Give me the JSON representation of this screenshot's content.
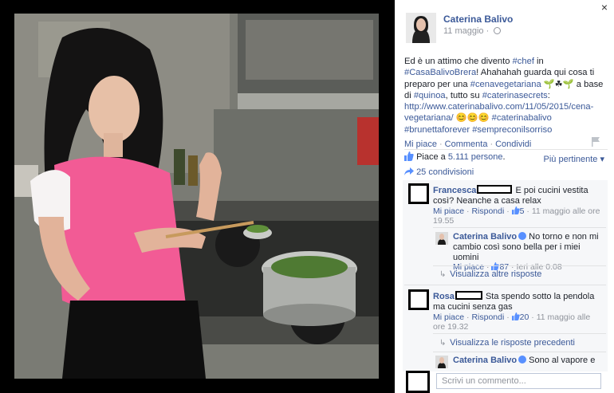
{
  "post": {
    "author": "Caterina Balivo",
    "date": "11 maggio · ",
    "text": {
      "p1": "Ed è un attimo che divento ",
      "tag_chef": "#chef",
      "p2": " in ",
      "tag_casa": "#CasaBalivoBrera",
      "p3": "! Ahahahah guarda qui cosa ti preparo per una ",
      "tag_cena": "#cenavegetariana",
      "emoji1": " 🌱☘🌱 ",
      "p4": "a base di ",
      "tag_quinoa": "#quinoa",
      "p5": ", tutto su ",
      "tag_secrets": "#caterinasecrets",
      "p6": ": ",
      "link": "http://www.caterinabalivo.com/11/05/2015/cena-vegetariana/",
      "emoji2": " 😊😊😊 ",
      "tag_cb": "#caterinabalivo",
      "tag_brunetta": "#brunettaforever",
      "tag_sorriso": "#sempreconilsorriso"
    }
  },
  "actions": {
    "like": "Mi piace",
    "comment": "Commenta",
    "share": "Condividi",
    "dot": "·"
  },
  "likes": {
    "prefix": "Piace a ",
    "count": "5.111 persone",
    "suffix": ".",
    "sort": "Più pertinente ▾"
  },
  "shares": {
    "label": "25 condivisioni"
  },
  "comments": [
    {
      "name": "Francesca",
      "text": " E poi cucini vestita così? Neanche a casa relax",
      "like": "Mi piace",
      "reply": "Rispondi",
      "likes": "5",
      "time": "11 maggio alle ore 19.55",
      "dot": " · "
    },
    {
      "name": "Caterina Balivo",
      "text": "No torno e non mi cambio così sono bella per i miei uomini",
      "like": "Mi piace",
      "likes": "87",
      "time": "Ieri alle 0.08",
      "dot": " · "
    },
    {
      "name": "Rosa",
      "text": " Sta spendo sotto la pendola ma cucini senza gas",
      "like": "Mi piace",
      "reply": "Rispondi",
      "likes": "20",
      "time": "11 maggio alle ore 19.32",
      "dot": " · "
    },
    {
      "name": "Caterina Balivo",
      "text": "Sono al vapore e"
    }
  ],
  "more_replies": "Visualizza altre risposte",
  "prev_replies": "Visualizza le risposte precedenti",
  "comment_input": {
    "placeholder": "Scrivi un commento..."
  },
  "close": "×",
  "colors": {
    "link": "#3b5998",
    "muted": "#90949c"
  }
}
